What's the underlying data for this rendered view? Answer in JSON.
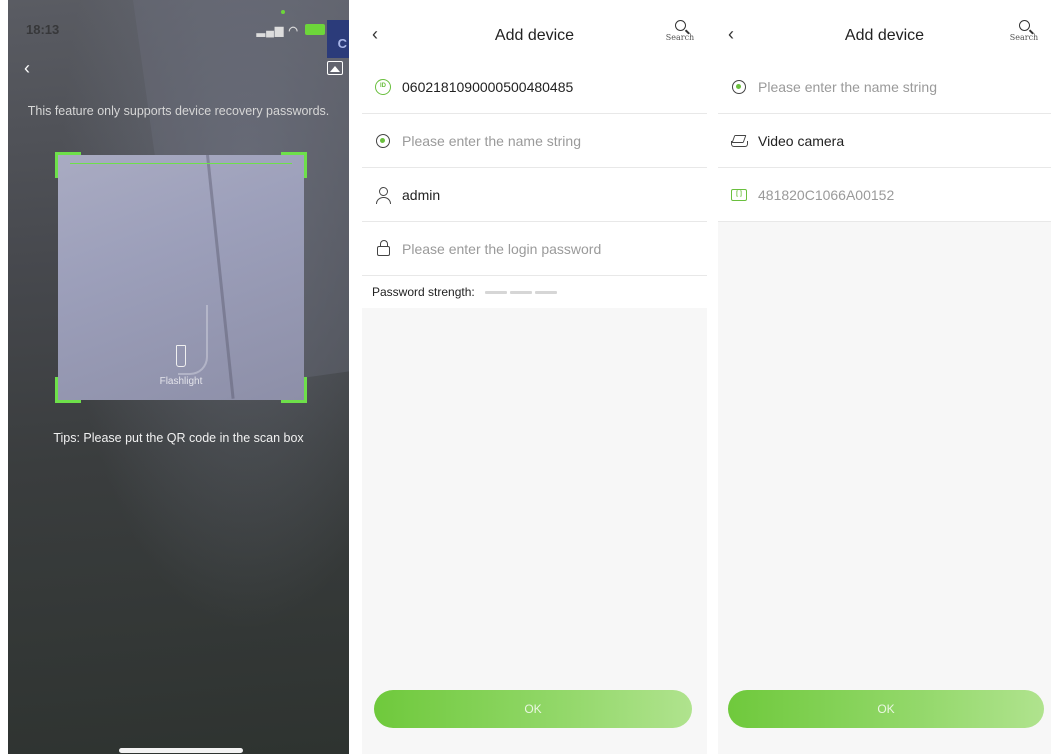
{
  "scanner": {
    "status_time": "18:13",
    "feature_note": "This feature only supports device recovery passwords.",
    "flashlight_label": "Flashlight",
    "tips": "Tips: Please put the QR code in the scan box",
    "accent_color": "#6ee04a"
  },
  "add_device_1": {
    "title": "Add device",
    "search_label": "Search",
    "device_id": "0602181090000500480485",
    "name_placeholder": "Please enter the name string",
    "username": "admin",
    "password_placeholder": "Please enter the login password",
    "password_strength_label": "Password strength:",
    "ok_label": "OK"
  },
  "add_device_2": {
    "title": "Add device",
    "search_label": "Search",
    "name_placeholder": "Please enter the name string",
    "device_type": "Video camera",
    "serial_number": "481820C1066A00152",
    "ok_label": "OK"
  },
  "icons": {
    "id": "id-badge-icon",
    "camera": "camera-icon",
    "user": "user-icon",
    "lock": "lock-icon",
    "layers": "layers-icon",
    "serial": "serial-number-icon"
  },
  "colors": {
    "button_gradient_start": "#6fc93c",
    "button_gradient_end": "#b0e38e",
    "icon_accent": "#6abf3e"
  }
}
